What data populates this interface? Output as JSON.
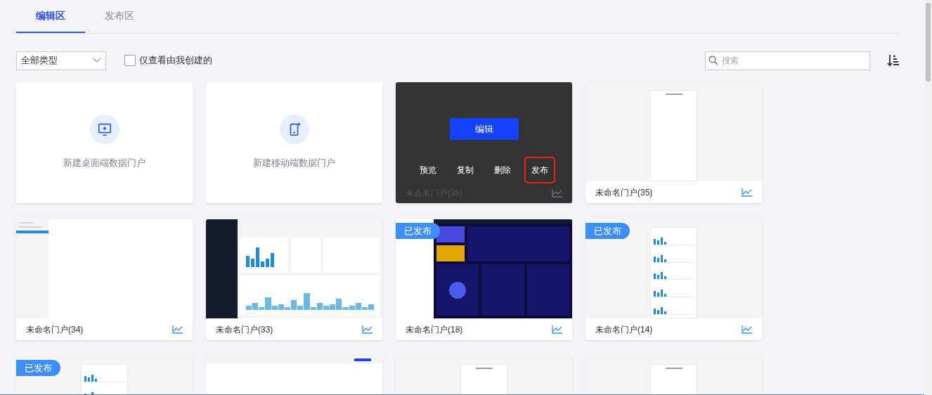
{
  "tabs": [
    {
      "label": "编辑区",
      "selected": true
    },
    {
      "label": "发布区",
      "selected": false
    }
  ],
  "filter": {
    "type_select": "全部类型",
    "only_mine": {
      "label": "仅查看由我创建的",
      "checked": false
    },
    "search": {
      "placeholder": "搜索"
    }
  },
  "cards": [
    {
      "kind": "new_desktop",
      "label": "新建桌面端数据门户"
    },
    {
      "kind": "new_mobile",
      "label": "新建移动端数据门户"
    },
    {
      "kind": "portal",
      "title": "未命名门户(36)",
      "preview": {
        "kind": "blank"
      },
      "published": false,
      "hovered": true,
      "primary_action": "编辑",
      "actions": [
        {
          "label": "预览",
          "highlighted": false
        },
        {
          "label": "复制",
          "highlighted": false
        },
        {
          "label": "删除",
          "highlighted": false
        },
        {
          "label": "发布",
          "highlighted": true
        }
      ]
    },
    {
      "kind": "portal",
      "title": "未命名门户(35)",
      "preview": {
        "kind": "mobile"
      },
      "published": false,
      "hovered": false
    },
    {
      "kind": "portal",
      "title": "未命名门户(34)",
      "preview": {
        "kind": "sidebar"
      },
      "published": false,
      "hovered": false
    },
    {
      "kind": "portal",
      "title": "未命名门户(33)",
      "preview": {
        "kind": "dark_sidebar"
      },
      "published": false,
      "hovered": false
    },
    {
      "kind": "portal",
      "title": "未命名门户(18)",
      "preview": {
        "kind": "dark"
      },
      "published": true,
      "badge": "已发布",
      "hovered": false
    },
    {
      "kind": "portal",
      "title": "未命名门户(14)",
      "preview": {
        "kind": "mobile_charts"
      },
      "published": true,
      "badge": "已发布",
      "hovered": false
    },
    {
      "kind": "portal",
      "preview": {
        "kind": "mobile_charts"
      },
      "published": true,
      "badge": "已发布",
      "hovered": false
    },
    {
      "kind": "portal",
      "preview": {
        "kind": "topbar"
      },
      "published": false,
      "hovered": false
    },
    {
      "kind": "portal",
      "preview": {
        "kind": "mobile"
      },
      "published": false,
      "hovered": false
    },
    {
      "kind": "portal",
      "preview": {
        "kind": "mobile"
      },
      "published": false,
      "hovered": false
    }
  ]
}
